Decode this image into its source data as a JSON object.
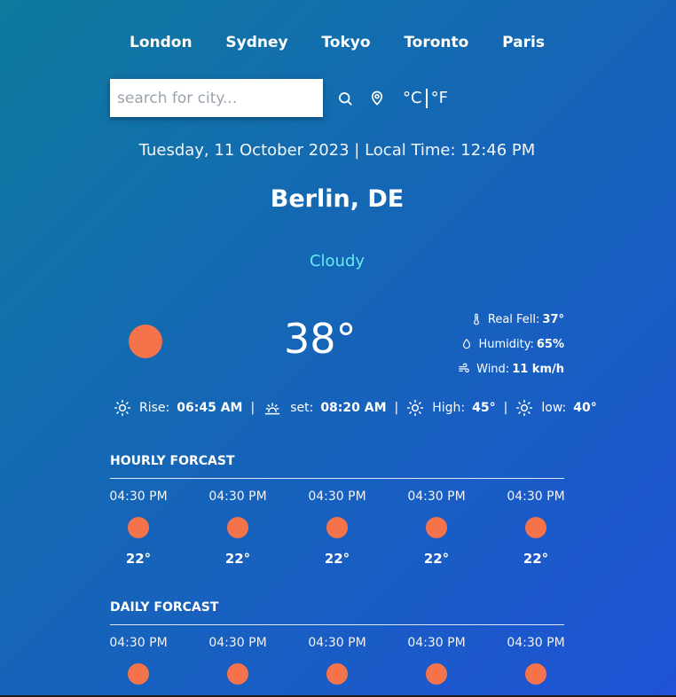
{
  "cities": [
    "London",
    "Sydney",
    "Tokyo",
    "Toronto",
    "Paris"
  ],
  "search": {
    "placeholder": "search for city...",
    "value": ""
  },
  "units": {
    "celsius": "°C",
    "fahrenheit": "°F"
  },
  "datetime": "Tuesday, 11 October 2023 | Local Time: 12:46 PM",
  "location": "Berlin, DE",
  "condition": "Cloudy",
  "current": {
    "temp": "38°",
    "details": [
      {
        "icon": "thermometer-icon",
        "label": "Real Fell:",
        "value": "37°"
      },
      {
        "icon": "droplet-icon",
        "label": "Humidity:",
        "value": "65%"
      },
      {
        "icon": "wind-icon",
        "label": "Wind:",
        "value": "11 km/h"
      }
    ]
  },
  "sun": {
    "rise_label": "Rise:",
    "rise_value": "06:45 AM",
    "set_label": "set:",
    "set_value": "08:20 AM",
    "high_label": "High:",
    "high_value": "45°",
    "low_label": "low:",
    "low_value": "40°",
    "separator": "|"
  },
  "hourly": {
    "title": "HOURLY FORCAST",
    "items": [
      {
        "time": "04:30 PM",
        "temp": "22°",
        "icon": "sun-icon"
      },
      {
        "time": "04:30 PM",
        "temp": "22°",
        "icon": "sun-icon"
      },
      {
        "time": "04:30 PM",
        "temp": "22°",
        "icon": "sun-icon"
      },
      {
        "time": "04:30 PM",
        "temp": "22°",
        "icon": "sun-icon"
      },
      {
        "time": "04:30 PM",
        "temp": "22°",
        "icon": "sun-icon"
      }
    ]
  },
  "daily": {
    "title": "DAILY FORCAST",
    "items": [
      {
        "time": "04:30 PM",
        "icon": "sun-icon"
      },
      {
        "time": "04:30 PM",
        "icon": "sun-icon"
      },
      {
        "time": "04:30 PM",
        "icon": "sun-icon"
      },
      {
        "time": "04:30 PM",
        "icon": "sun-icon"
      },
      {
        "time": "04:30 PM",
        "icon": "sun-icon"
      }
    ]
  },
  "colors": {
    "accent_sun": "#f4734b",
    "condition_text": "#67e8f9",
    "gradient_start": "#0e7a9e",
    "gradient_end": "#1f52d6"
  }
}
